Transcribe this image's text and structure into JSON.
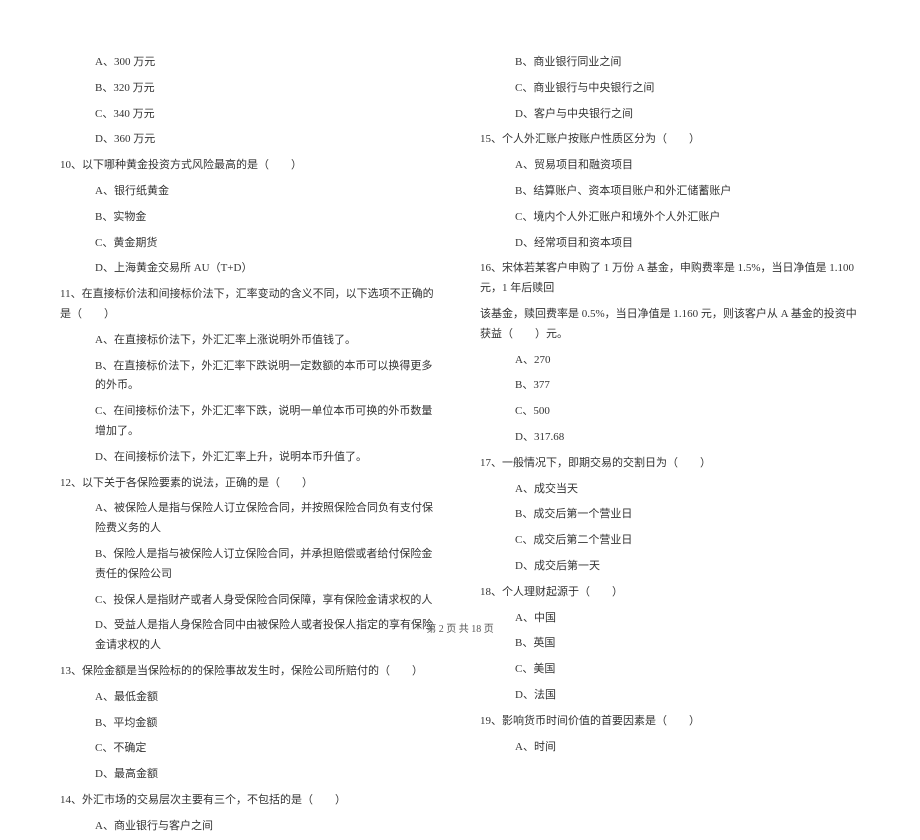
{
  "left_column": {
    "q9_options": [
      "A、300 万元",
      "B、320 万元",
      "C、340 万元",
      "D、360 万元"
    ],
    "q10": {
      "text": "10、以下哪种黄金投资方式风险最高的是（　　）",
      "options": [
        "A、银行纸黄金",
        "B、实物金",
        "C、黄金期货",
        "D、上海黄金交易所 AU（T+D）"
      ]
    },
    "q11": {
      "text": "11、在直接标价法和间接标价法下，汇率变动的含义不同，以下选项不正确的是（　　）",
      "options": [
        "A、在直接标价法下，外汇汇率上涨说明外币值钱了。",
        "B、在直接标价法下，外汇汇率下跌说明一定数额的本币可以换得更多的外币。",
        "C、在间接标价法下，外汇汇率下跌，说明一单位本币可换的外币数量增加了。",
        "D、在间接标价法下，外汇汇率上升，说明本币升值了。"
      ]
    },
    "q12": {
      "text": "12、以下关于各保险要素的说法，正确的是（　　）",
      "options": [
        "A、被保险人是指与保险人订立保险合同，并按照保险合同负有支付保险费义务的人",
        "B、保险人是指与被保险人订立保险合同，并承担赔偿或者给付保险金责任的保险公司",
        "C、投保人是指财产或者人身受保险合同保障，享有保险金请求权的人",
        "D、受益人是指人身保险合同中由被保险人或者投保人指定的享有保险金请求权的人"
      ]
    },
    "q13": {
      "text": "13、保险金额是当保险标的的保险事故发生时，保险公司所赔付的（　　）",
      "options": [
        "A、最低金额",
        "B、平均金额",
        "C、不确定",
        "D、最高金额"
      ]
    },
    "q14": {
      "text": "14、外汇市场的交易层次主要有三个，不包括的是（　　）",
      "options": [
        "A、商业银行与客户之间"
      ]
    }
  },
  "right_column": {
    "q14_options": [
      "B、商业银行同业之间",
      "C、商业银行与中央银行之间",
      "D、客户与中央银行之间"
    ],
    "q15": {
      "text": "15、个人外汇账户按账户性质区分为（　　）",
      "options": [
        "A、贸易项目和融资项目",
        "B、结算账户、资本项目账户和外汇储蓄账户",
        "C、境内个人外汇账户和境外个人外汇账户",
        "D、经常项目和资本项目"
      ]
    },
    "q16": {
      "text_line1": "16、宋体若某客户申购了 1 万份 A 基金，申购费率是 1.5%，当日净值是 1.100 元，1 年后赎回",
      "text_line2": "该基金，赎回费率是 0.5%，当日净值是 1.160 元，则该客户从 A 基金的投资中获益（　　）元。",
      "options": [
        "A、270",
        "B、377",
        "C、500",
        "D、317.68"
      ]
    },
    "q17": {
      "text": "17、一般情况下，即期交易的交割日为（　　）",
      "options": [
        "A、成交当天",
        "B、成交后第一个营业日",
        "C、成交后第二个营业日",
        "D、成交后第一天"
      ]
    },
    "q18": {
      "text": "18、个人理财起源于（　　）",
      "options": [
        "A、中国",
        "B、英国",
        "C、美国",
        "D、法国"
      ]
    },
    "q19": {
      "text": "19、影响货币时间价值的首要因素是（　　）",
      "options": [
        "A、时间"
      ]
    }
  },
  "footer": "第 2 页 共 18 页"
}
